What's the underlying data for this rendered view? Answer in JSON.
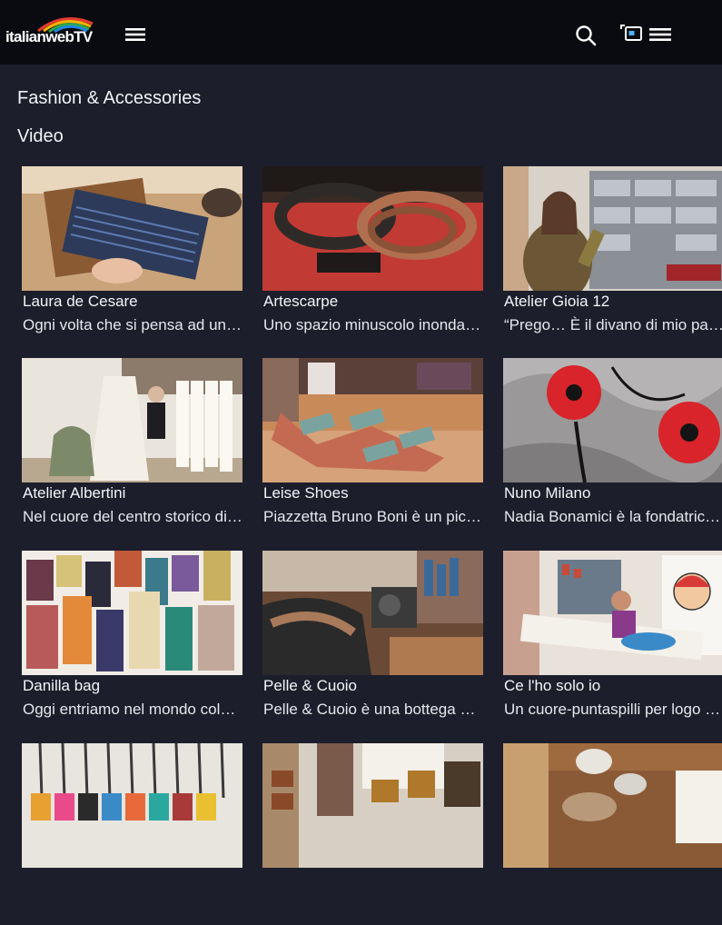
{
  "header": {
    "logo_text": "italianwebTV",
    "icons": [
      "hamburger-menu-icon",
      "search-icon",
      "cast-icon",
      "menu-icon"
    ]
  },
  "page": {
    "title": "Fashion & Accessories",
    "section": "Video"
  },
  "videos": [
    {
      "title": "Laura de Cesare",
      "desc": "Ogni volta che si pensa ad una bottega artigiana"
    },
    {
      "title": "Artescarpe",
      "desc": "Uno spazio minuscolo inondato di pelli e cinture"
    },
    {
      "title": "Atelier Gioia 12",
      "desc": "“Prego… È il divano di mio padre”"
    },
    {
      "title": "Atelier Albertini",
      "desc": "Nel cuore del centro storico di Milano"
    },
    {
      "title": "Leise Shoes",
      "desc": "Piazzetta Bruno Boni è un piccolo gioiello"
    },
    {
      "title": "Nuno Milano",
      "desc": "Nadia Bonamici è la fondatrice del brand"
    },
    {
      "title": "Danilla bag",
      "desc": "Oggi entriamo nel mondo colorato delle borse"
    },
    {
      "title": "Pelle & Cuoio",
      "desc": "Pelle & Cuoio è una bottega artigiana storica"
    },
    {
      "title": "Ce l'ho solo io",
      "desc": "Un cuore-puntaspilli per logo e mille idee"
    },
    {
      "title": "",
      "desc": ""
    },
    {
      "title": "",
      "desc": ""
    },
    {
      "title": "",
      "desc": ""
    }
  ]
}
